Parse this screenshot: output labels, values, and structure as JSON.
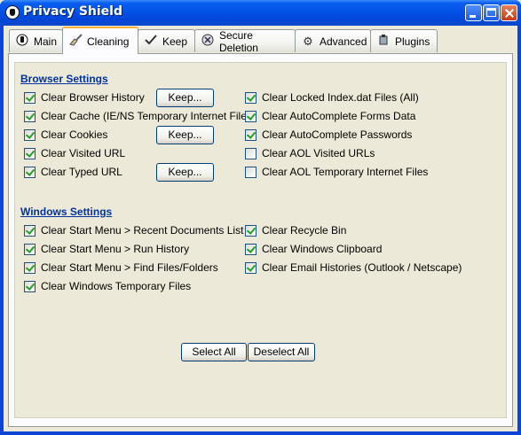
{
  "window": {
    "title": "Privacy Shield"
  },
  "tabs": [
    {
      "label": "Main",
      "icon": "info-icon"
    },
    {
      "label": "Cleaning",
      "icon": "broom-icon"
    },
    {
      "label": "Keep",
      "icon": "check-icon"
    },
    {
      "label": "Secure Deletion",
      "icon": "shield-icon"
    },
    {
      "label": "Advanced",
      "icon": "gear-icon"
    },
    {
      "label": "Plugins",
      "icon": "plugin-icon"
    }
  ],
  "active_tab": "Cleaning",
  "browser": {
    "title": "Browser Settings",
    "keep_label": "Keep...",
    "items": [
      {
        "label": "Clear Browser History",
        "checked": true
      },
      {
        "label": "Clear Cache (IE/NS Temporary Internet Files)",
        "checked": true
      },
      {
        "label": "Clear Cookies",
        "checked": true
      },
      {
        "label": "Clear Visited URL",
        "checked": true
      },
      {
        "label": "Clear Typed URL",
        "checked": true
      },
      {
        "label": "Clear Locked Index.dat Files (All)",
        "checked": true
      },
      {
        "label": "Clear AutoComplete Forms Data",
        "checked": true
      },
      {
        "label": "Clear AutoComplete Passwords",
        "checked": true
      },
      {
        "label": "Clear AOL Visited URLs",
        "checked": false
      },
      {
        "label": "Clear AOL Temporary Internet Files",
        "checked": false
      }
    ]
  },
  "windows": {
    "title": "Windows Settings",
    "items": [
      {
        "label": "Clear Start Menu > Recent Documents List",
        "checked": true
      },
      {
        "label": "Clear Start Menu > Run History",
        "checked": true
      },
      {
        "label": "Clear Start Menu > Find Files/Folders",
        "checked": true
      },
      {
        "label": "Clear Windows Temporary Files",
        "checked": true
      },
      {
        "label": "Clear Recycle Bin",
        "checked": true
      },
      {
        "label": "Clear Windows Clipboard",
        "checked": true
      },
      {
        "label": "Clear Email Histories (Outlook / Netscape)",
        "checked": true
      }
    ]
  },
  "buttons": {
    "select_all": "Select All",
    "deselect_all": "Deselect All"
  },
  "colors": {
    "titlebar": "#0352e6",
    "section_title": "#0033a0",
    "check": "#21a121",
    "face": "#ece9d8"
  }
}
